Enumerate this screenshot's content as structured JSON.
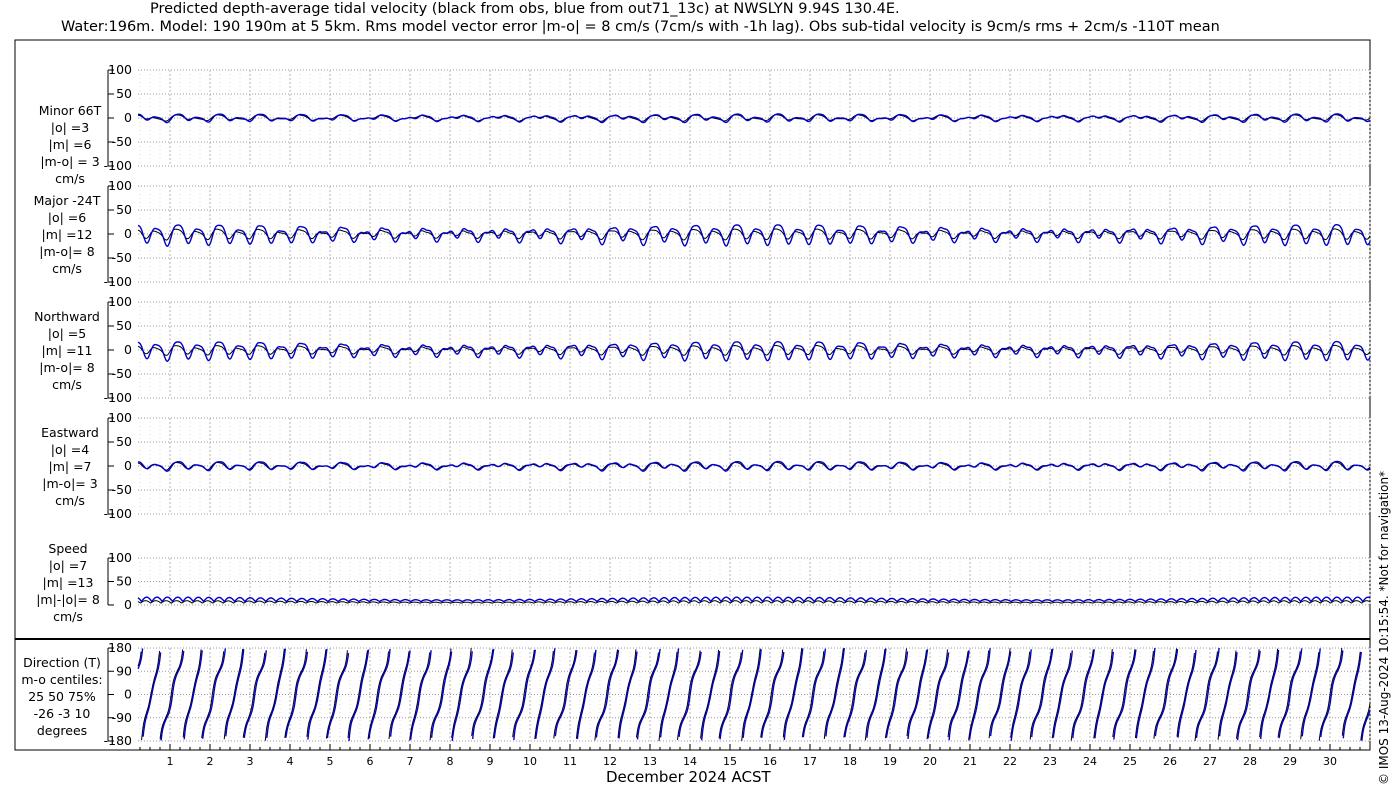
{
  "title_line1": "Predicted depth-average tidal velocity (black from obs, blue from out71_13c) at NWSLYN 9.94S 130.4E.",
  "title_line2": "Water:196m. Model: 190 190m at 5 5km. Rms model vector error |m-o| = 8 cm/s (7cm/s with -1h lag). Obs sub-tidal velocity is 9cm/s rms + 2cm/s -110T mean",
  "x_axis_label": "December 2024 ACST",
  "credit": "© IMOS 13-Aug-2024 10:15:54. *Not for navigation*",
  "colors": {
    "obs": "#000000",
    "model": "#0000cc",
    "grid": "#9a9a9a"
  },
  "chart_data": [
    {
      "type": "line",
      "id": "minor",
      "label_lines": [
        "Minor 66T",
        "|o| =3",
        "|m| =6",
        "|m-o| = 3",
        "cm/s"
      ],
      "ylim": [
        -100,
        100
      ],
      "yticks": [
        -100,
        -50,
        0,
        50,
        100
      ],
      "xlim": [
        0.2,
        31
      ],
      "grid": true,
      "series": [
        {
          "role": "obs",
          "amplitude": 3,
          "diurnal_amplitude": 4,
          "offset": 0
        },
        {
          "role": "model",
          "amplitude": 5,
          "diurnal_amplitude": 4,
          "offset": 0
        }
      ]
    },
    {
      "type": "line",
      "id": "major",
      "label_lines": [
        "Major -24T",
        "|o| =6",
        "|m| =12",
        "|m-o|= 8",
        "cm/s"
      ],
      "ylim": [
        -100,
        100
      ],
      "yticks": [
        -100,
        -50,
        0,
        50,
        100
      ],
      "xlim": [
        0.2,
        31
      ],
      "grid": true,
      "series": [
        {
          "role": "obs",
          "amplitude": 8,
          "diurnal_amplitude": 3,
          "offset": 0
        },
        {
          "role": "model",
          "amplitude": 16,
          "diurnal_amplitude": 5,
          "offset": 0
        }
      ]
    },
    {
      "type": "line",
      "id": "northward",
      "label_lines": [
        "Northward",
        "|o| =5",
        "|m| =11",
        "|m-o|= 8",
        "cm/s"
      ],
      "ylim": [
        -100,
        100
      ],
      "yticks": [
        -100,
        -50,
        0,
        50,
        100
      ],
      "xlim": [
        0.2,
        31
      ],
      "grid": true,
      "series": [
        {
          "role": "obs",
          "amplitude": 7,
          "diurnal_amplitude": 3,
          "offset": 0
        },
        {
          "role": "model",
          "amplitude": 15,
          "diurnal_amplitude": 4,
          "offset": 0
        }
      ]
    },
    {
      "type": "line",
      "id": "eastward",
      "label_lines": [
        "Eastward",
        "|o| =4",
        "|m| =7",
        "|m-o|= 3",
        "cm/s"
      ],
      "ylim": [
        -100,
        100
      ],
      "yticks": [
        -100,
        -50,
        0,
        50,
        100
      ],
      "xlim": [
        0.2,
        31
      ],
      "grid": true,
      "series": [
        {
          "role": "obs",
          "amplitude": 5,
          "diurnal_amplitude": 3,
          "offset": 0
        },
        {
          "role": "model",
          "amplitude": 6,
          "diurnal_amplitude": 4,
          "offset": 0
        }
      ]
    },
    {
      "type": "line",
      "id": "speed",
      "label_lines": [
        "Speed",
        "|o| =7",
        "|m| =13",
        "|m|-|o|= 8",
        "cm/s"
      ],
      "ylim": [
        0,
        100
      ],
      "yticks": [
        0,
        50,
        100
      ],
      "xlim": [
        0.2,
        31
      ],
      "grid": true,
      "series": [
        {
          "role": "obs",
          "amplitude": 5,
          "offset": 6
        },
        {
          "role": "model",
          "amplitude": 9,
          "offset": 11
        }
      ]
    },
    {
      "type": "line",
      "id": "direction",
      "label_lines": [
        "Direction (T)",
        "m-o centiles:",
        "25  50  75%",
        "-26  -3  10",
        "degrees"
      ],
      "ylim": [
        -180,
        180
      ],
      "yticks": [
        -180,
        -90,
        0,
        90,
        180
      ],
      "xlim": [
        0.2,
        31
      ],
      "grid": true,
      "series": [
        {
          "role": "obs",
          "mean_direction": 0
        },
        {
          "role": "model",
          "mean_direction": 0
        }
      ]
    }
  ],
  "x_ticks": [
    1,
    2,
    3,
    4,
    5,
    6,
    7,
    8,
    9,
    10,
    11,
    12,
    13,
    14,
    15,
    16,
    17,
    18,
    19,
    20,
    21,
    22,
    23,
    24,
    25,
    26,
    27,
    28,
    29,
    30
  ],
  "x_minor_step": 0.25
}
